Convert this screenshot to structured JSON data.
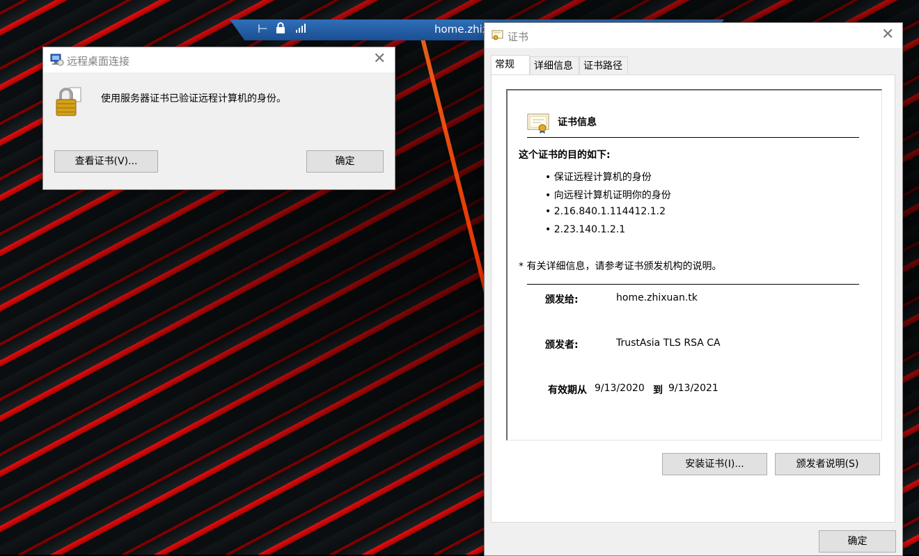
{
  "taskbar": {
    "host": "home.zhix"
  },
  "rdp_dialog": {
    "title": "远程桌面连接",
    "message": "使用服务器证书已验证远程计算机的身份。",
    "view_cert_button": "查看证书(V)...",
    "ok_button": "确定"
  },
  "cert_dialog": {
    "title": "证书",
    "tabs": [
      "常规",
      "详细信息",
      "证书路径"
    ],
    "info_header": "证书信息",
    "purpose_heading": "这个证书的目的如下:",
    "purposes": [
      "保证远程计算机的身份",
      "向远程计算机证明你的身份",
      "2.16.840.1.114412.1.2",
      "2.23.140.1.2.1"
    ],
    "note": "* 有关详细信息，请参考证书颁发机构的说明。",
    "issued_to_label": "颁发给:",
    "issued_to": "home.zhixuan.tk",
    "issued_by_label": "颁发者:",
    "issued_by": "TrustAsia TLS RSA CA",
    "valid_from_label": "有效期从",
    "valid_from": "9/13/2020",
    "valid_to_label": "到",
    "valid_to": "9/13/2021",
    "install_button": "安装证书(I)...",
    "issuer_statement_button": "颁发者说明(S)",
    "ok_button": "确定"
  }
}
